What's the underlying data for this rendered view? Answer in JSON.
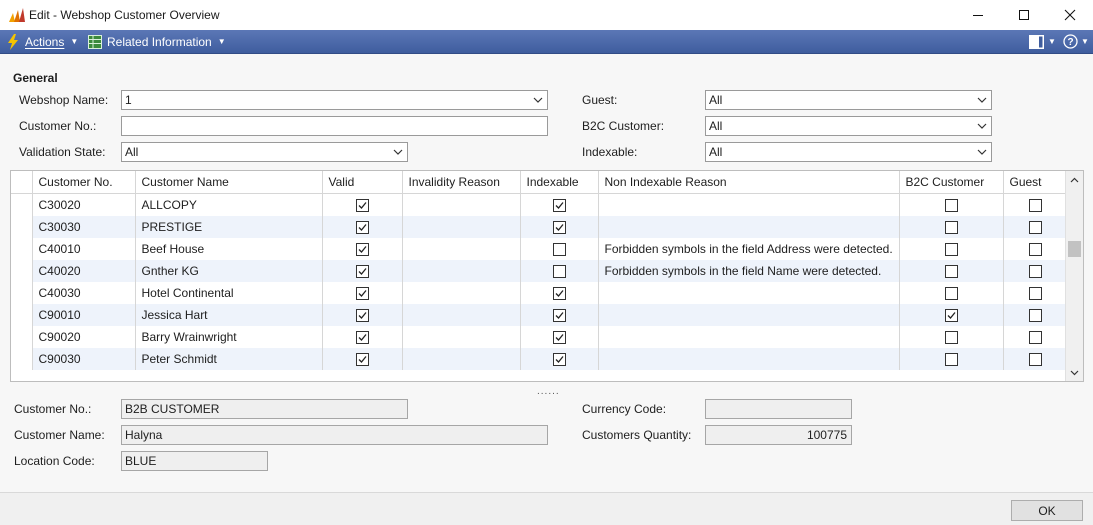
{
  "window": {
    "title": "Edit - Webshop Customer Overview"
  },
  "actionbar": {
    "actions_label": "Actions",
    "related_label": "Related Information"
  },
  "general": {
    "section_title": "General",
    "webshop_name_label": "Webshop Name:",
    "webshop_name_value": "1",
    "customer_no_label": "Customer No.:",
    "customer_no_value": "",
    "validation_state_label": "Validation State:",
    "validation_state_value": "All",
    "guest_label": "Guest:",
    "guest_value": "All",
    "b2c_customer_label": "B2C Customer:",
    "b2c_customer_value": "All",
    "indexable_label": "Indexable:",
    "indexable_value": "All"
  },
  "grid": {
    "columns": [
      "Customer No.",
      "Customer Name",
      "Valid",
      "Invalidity Reason",
      "Indexable",
      "Non Indexable Reason",
      "B2C Customer",
      "Guest"
    ],
    "rows": [
      {
        "customer_no": "C30020",
        "customer_name": "ALLCOPY",
        "valid": true,
        "invalidity_reason": "",
        "indexable": true,
        "non_indexable_reason": "",
        "b2c": false,
        "guest": false
      },
      {
        "customer_no": "C30030",
        "customer_name": "PRESTIGE",
        "valid": true,
        "invalidity_reason": "",
        "indexable": true,
        "non_indexable_reason": "",
        "b2c": false,
        "guest": false
      },
      {
        "customer_no": "C40010",
        "customer_name": "Beef House",
        "valid": true,
        "invalidity_reason": "",
        "indexable": false,
        "non_indexable_reason": "Forbidden symbols in the field Address were detected.",
        "b2c": false,
        "guest": false
      },
      {
        "customer_no": "C40020",
        "customer_name": "Gnther KG",
        "valid": true,
        "invalidity_reason": "",
        "indexable": false,
        "non_indexable_reason": "Forbidden symbols in the field Name were detected.",
        "b2c": false,
        "guest": false
      },
      {
        "customer_no": "C40030",
        "customer_name": "Hotel Continental",
        "valid": true,
        "invalidity_reason": "",
        "indexable": true,
        "non_indexable_reason": "",
        "b2c": false,
        "guest": false
      },
      {
        "customer_no": "C90010",
        "customer_name": "Jessica Hart",
        "valid": true,
        "invalidity_reason": "",
        "indexable": true,
        "non_indexable_reason": "",
        "b2c": true,
        "guest": false
      },
      {
        "customer_no": "C90020",
        "customer_name": "Barry Wrainwright",
        "valid": true,
        "invalidity_reason": "",
        "indexable": true,
        "non_indexable_reason": "",
        "b2c": false,
        "guest": false
      },
      {
        "customer_no": "C90030",
        "customer_name": "Peter Schmidt",
        "valid": true,
        "invalidity_reason": "",
        "indexable": true,
        "non_indexable_reason": "",
        "b2c": false,
        "guest": false
      }
    ]
  },
  "splitter_text": "......",
  "details": {
    "customer_no_label": "Customer No.:",
    "customer_no_value": "B2B CUSTOMER",
    "customer_name_label": "Customer Name:",
    "customer_name_value": "Halyna",
    "location_code_label": "Location Code:",
    "location_code_value": "BLUE",
    "currency_code_label": "Currency Code:",
    "currency_code_value": "",
    "customers_quantity_label": "Customers Quantity:",
    "customers_quantity_value": "100775"
  },
  "footer": {
    "ok_label": "OK"
  },
  "colors": {
    "actionbar": "#4a66a8",
    "row_alt": "#eef3fb",
    "bolt": "#f5c400"
  }
}
